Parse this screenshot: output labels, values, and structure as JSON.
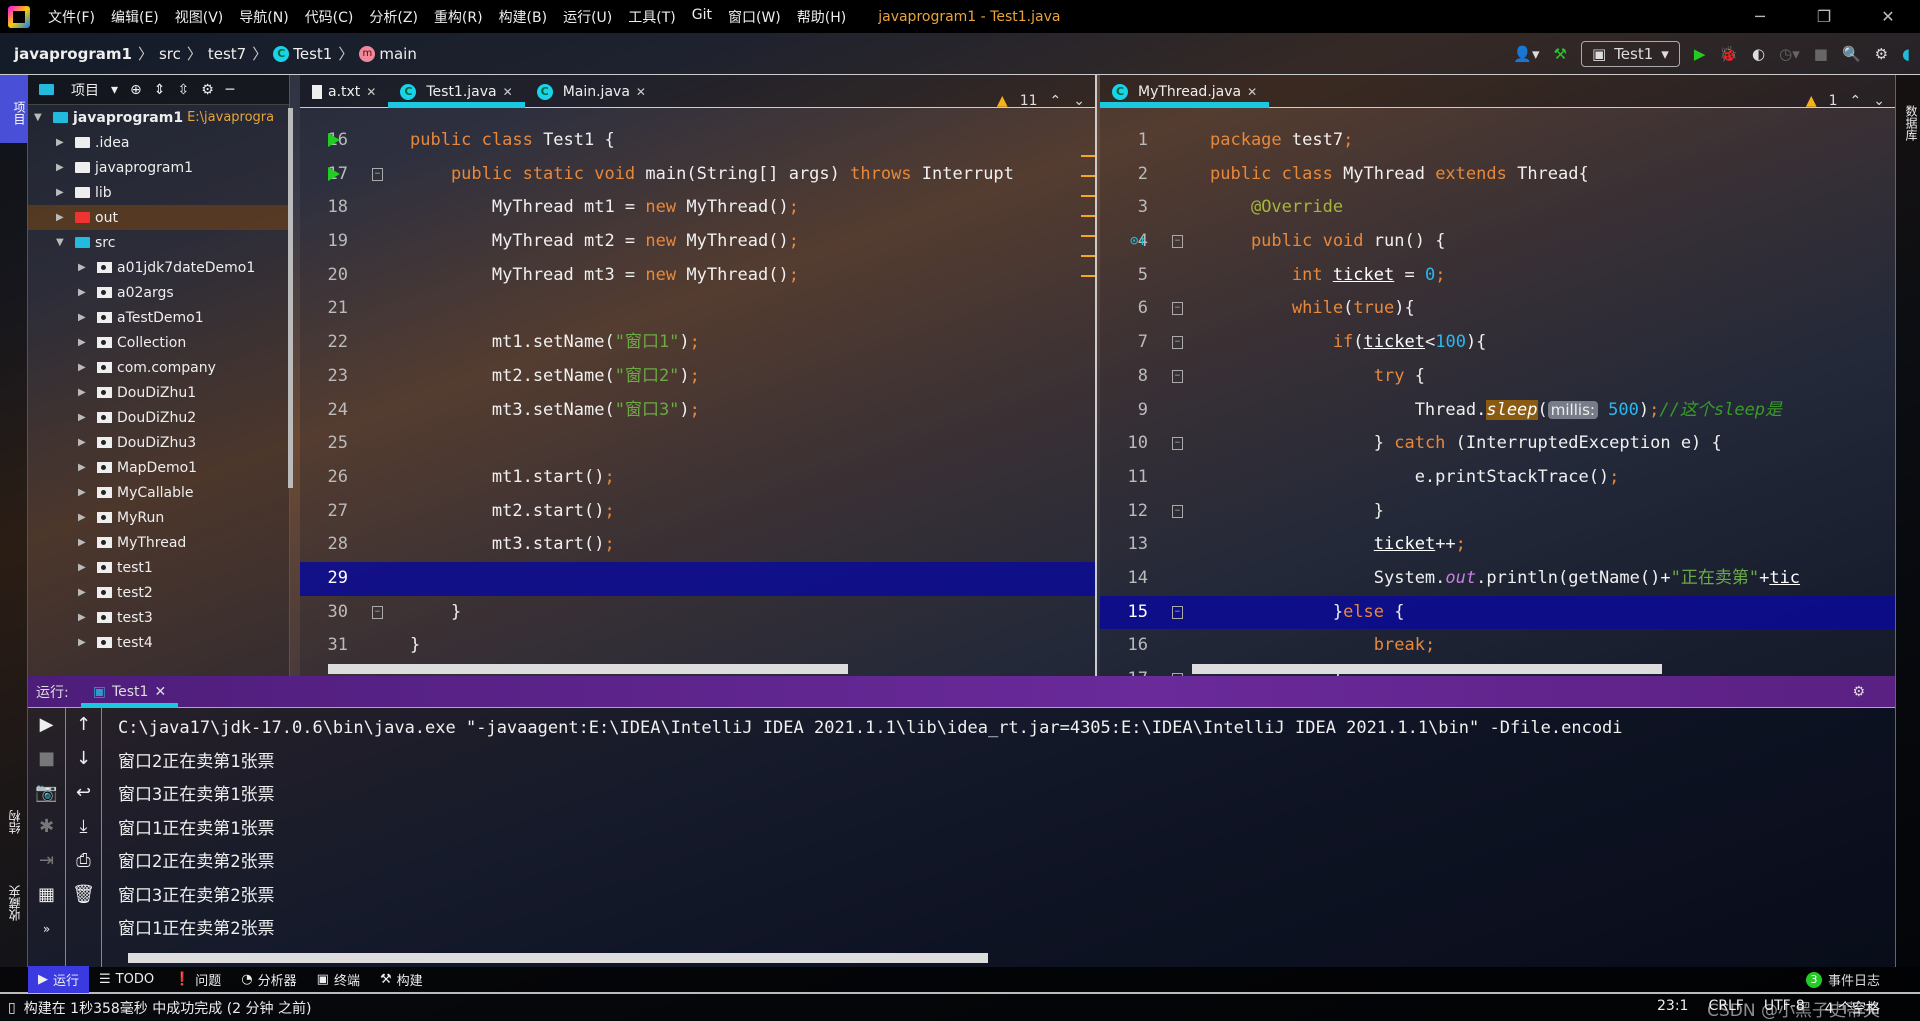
{
  "window": {
    "title": "javaprogram1 - Test1.java",
    "menu": [
      "文件(F)",
      "编辑(E)",
      "视图(V)",
      "导航(N)",
      "代码(C)",
      "分析(Z)",
      "重构(R)",
      "构建(B)",
      "运行(U)",
      "工具(T)",
      "Git",
      "窗口(W)",
      "帮助(H)"
    ]
  },
  "breadcrumb": {
    "project": "javaprogram1",
    "src": "src",
    "pkg": "test7",
    "cls": "Test1",
    "method": "main"
  },
  "toolbar": {
    "run_config": "Test1"
  },
  "left_stripe": {
    "project": "项目",
    "structure": "结构",
    "favorites": "收藏夹"
  },
  "right_stripe": {
    "database": "数据库"
  },
  "project": {
    "title": "项目",
    "root": "javaprogram1",
    "root_path": "E:\\javaprogra",
    "items": [
      {
        "label": ".idea",
        "type": "folder",
        "depth": 1
      },
      {
        "label": "javaprogram1",
        "type": "folder",
        "depth": 1
      },
      {
        "label": "lib",
        "type": "folder",
        "depth": 1
      },
      {
        "label": "out",
        "type": "folder-red",
        "depth": 1
      },
      {
        "label": "src",
        "type": "folder-blue",
        "depth": 1,
        "open": true
      },
      {
        "label": "a01jdk7dateDemo1",
        "type": "pkg",
        "depth": 2
      },
      {
        "label": "a02args",
        "type": "pkg",
        "depth": 2
      },
      {
        "label": "aTestDemo1",
        "type": "pkg",
        "depth": 2
      },
      {
        "label": "Collection",
        "type": "pkg",
        "depth": 2
      },
      {
        "label": "com.company",
        "type": "pkg",
        "depth": 2
      },
      {
        "label": "DouDiZhu1",
        "type": "pkg",
        "depth": 2
      },
      {
        "label": "DouDiZhu2",
        "type": "pkg",
        "depth": 2
      },
      {
        "label": "DouDiZhu3",
        "type": "pkg",
        "depth": 2
      },
      {
        "label": "MapDemo1",
        "type": "pkg",
        "depth": 2
      },
      {
        "label": "MyCallable",
        "type": "pkg",
        "depth": 2
      },
      {
        "label": "MyRun",
        "type": "pkg",
        "depth": 2
      },
      {
        "label": "MyThread",
        "type": "pkg",
        "depth": 2
      },
      {
        "label": "test1",
        "type": "pkg",
        "depth": 2
      },
      {
        "label": "test2",
        "type": "pkg",
        "depth": 2
      },
      {
        "label": "test3",
        "type": "pkg",
        "depth": 2
      },
      {
        "label": "test4",
        "type": "pkg",
        "depth": 2
      }
    ]
  },
  "editor1": {
    "tabs": [
      {
        "label": "a.txt",
        "icon": "text-file-icon"
      },
      {
        "label": "Test1.java",
        "icon": "class-icon",
        "active": true
      },
      {
        "label": "Main.java",
        "icon": "class-icon"
      }
    ],
    "warnings": "11",
    "current_line": "29",
    "lines": [
      {
        "n": "16",
        "run": true,
        "t": [
          [
            "public class ",
            "k"
          ],
          [
            "Test1 {",
            "plain"
          ]
        ]
      },
      {
        "n": "17",
        "run": true,
        "fold": true,
        "t": [
          [
            "    public static void ",
            "k"
          ],
          [
            "main",
            "f"
          ],
          [
            "(String[] args) ",
            "plain"
          ],
          [
            "throws ",
            "k"
          ],
          [
            "Interrupt",
            "plain"
          ]
        ]
      },
      {
        "n": "18",
        "t": [
          [
            "        MyThread mt1 = ",
            "plain"
          ],
          [
            "new ",
            "k"
          ],
          [
            "MyThread()",
            "plain"
          ],
          [
            ";",
            "k"
          ]
        ]
      },
      {
        "n": "19",
        "t": [
          [
            "        MyThread mt2 = ",
            "plain"
          ],
          [
            "new ",
            "k"
          ],
          [
            "MyThread()",
            "plain"
          ],
          [
            ";",
            "k"
          ]
        ]
      },
      {
        "n": "20",
        "t": [
          [
            "        MyThread mt3 = ",
            "plain"
          ],
          [
            "new ",
            "k"
          ],
          [
            "MyThread()",
            "plain"
          ],
          [
            ";",
            "k"
          ]
        ]
      },
      {
        "n": "21",
        "t": []
      },
      {
        "n": "22",
        "t": [
          [
            "        mt1.setName(",
            "plain"
          ],
          [
            "\"窗口1\"",
            "s"
          ],
          [
            ")",
            "plain"
          ],
          [
            ";",
            "k"
          ]
        ]
      },
      {
        "n": "23",
        "t": [
          [
            "        mt2.setName(",
            "plain"
          ],
          [
            "\"窗口2\"",
            "s"
          ],
          [
            ")",
            "plain"
          ],
          [
            ";",
            "k"
          ]
        ]
      },
      {
        "n": "24",
        "t": [
          [
            "        mt3.setName(",
            "plain"
          ],
          [
            "\"窗口3\"",
            "s"
          ],
          [
            ")",
            "plain"
          ],
          [
            ";",
            "k"
          ]
        ]
      },
      {
        "n": "25",
        "t": []
      },
      {
        "n": "26",
        "t": [
          [
            "        mt1.start()",
            "plain"
          ],
          [
            ";",
            "k"
          ]
        ]
      },
      {
        "n": "27",
        "t": [
          [
            "        mt2.start()",
            "plain"
          ],
          [
            ";",
            "k"
          ]
        ]
      },
      {
        "n": "28",
        "t": [
          [
            "        mt3.start()",
            "plain"
          ],
          [
            ";",
            "k"
          ]
        ]
      },
      {
        "n": "29",
        "cur": true,
        "t": []
      },
      {
        "n": "30",
        "fold": true,
        "t": [
          [
            "    }",
            "plain"
          ]
        ]
      },
      {
        "n": "31",
        "t": [
          [
            "}",
            "plain"
          ]
        ]
      }
    ]
  },
  "editor2": {
    "tabs": [
      {
        "label": "MyThread.java",
        "icon": "class-icon",
        "active": true
      }
    ],
    "warnings": "1",
    "current_line": "15",
    "lines": [
      {
        "n": "1",
        "t": [
          [
            "package ",
            "k"
          ],
          [
            "test7",
            "plain"
          ],
          [
            ";",
            "k"
          ]
        ]
      },
      {
        "n": "2",
        "t": [
          [
            "public class ",
            "k"
          ],
          [
            "MyThread ",
            "plain"
          ],
          [
            "extends ",
            "k"
          ],
          [
            "Thread{",
            "plain"
          ]
        ]
      },
      {
        "n": "3",
        "t": [
          [
            "    ",
            "plain"
          ],
          [
            "@Override",
            "a"
          ]
        ]
      },
      {
        "n": "4",
        "override": true,
        "fold": true,
        "t": [
          [
            "    public void ",
            "k"
          ],
          [
            "run",
            "f"
          ],
          [
            "() {",
            "plain"
          ]
        ]
      },
      {
        "n": "5",
        "t": [
          [
            "        int ",
            "k"
          ],
          [
            "ticket",
            "u"
          ],
          [
            " = ",
            "plain"
          ],
          [
            "0",
            "n"
          ],
          [
            ";",
            "k"
          ]
        ]
      },
      {
        "n": "6",
        "fold": true,
        "t": [
          [
            "        while",
            "k"
          ],
          [
            "(",
            "plain"
          ],
          [
            "true",
            "k"
          ],
          [
            "){",
            "plain"
          ]
        ]
      },
      {
        "n": "7",
        "fold": true,
        "t": [
          [
            "            if",
            "k"
          ],
          [
            "(",
            "plain"
          ],
          [
            "ticket",
            "u"
          ],
          [
            "<",
            "plain"
          ],
          [
            "100",
            "n"
          ],
          [
            "){",
            "plain"
          ]
        ]
      },
      {
        "n": "8",
        "fold": true,
        "t": [
          [
            "                try ",
            "k"
          ],
          [
            "{",
            "plain"
          ]
        ]
      },
      {
        "n": "9",
        "t": [
          [
            "                    Thread.",
            "plain"
          ],
          [
            "sleep",
            "sl"
          ],
          [
            "(",
            "plain"
          ],
          [
            "millis:",
            "ph"
          ],
          [
            " 500",
            "n"
          ],
          [
            ")",
            "plain"
          ],
          [
            ";",
            "k"
          ],
          [
            "//这个sleep是",
            "c"
          ]
        ]
      },
      {
        "n": "10",
        "fold": true,
        "t": [
          [
            "                } ",
            "plain"
          ],
          [
            "catch ",
            "k"
          ],
          [
            "(InterruptedException e) {",
            "plain"
          ]
        ]
      },
      {
        "n": "11",
        "t": [
          [
            "                    e.printStackTrace()",
            "plain"
          ],
          [
            ";",
            "k"
          ]
        ]
      },
      {
        "n": "12",
        "fold": true,
        "t": [
          [
            "                }",
            "plain"
          ]
        ]
      },
      {
        "n": "13",
        "t": [
          [
            "                ",
            "plain"
          ],
          [
            "ticket",
            "u"
          ],
          [
            "++",
            "plain"
          ],
          [
            ";",
            "k"
          ]
        ]
      },
      {
        "n": "14",
        "t": [
          [
            "                System.",
            "plain"
          ],
          [
            "out",
            "it"
          ],
          [
            ".println(getName()+",
            "plain"
          ],
          [
            "\"正在卖第\"",
            "s"
          ],
          [
            "+",
            "plain"
          ],
          [
            "tic",
            "u"
          ]
        ]
      },
      {
        "n": "15",
        "cur": true,
        "fold": true,
        "t": [
          [
            "            }",
            "plain"
          ],
          [
            "else ",
            "k"
          ],
          [
            "{",
            "plain"
          ]
        ]
      },
      {
        "n": "16",
        "t": [
          [
            "                break",
            "k"
          ],
          [
            ";",
            "k"
          ]
        ]
      },
      {
        "n": "17",
        "fold": true,
        "t": [
          [
            "            }",
            "plain"
          ]
        ]
      }
    ]
  },
  "run": {
    "label": "运行:",
    "tab": "Test1",
    "output": [
      "C:\\java17\\jdk-17.0.6\\bin\\java.exe \"-javaagent:E:\\IDEA\\IntelliJ IDEA 2021.1.1\\lib\\idea_rt.jar=4305:E:\\IDEA\\IntelliJ IDEA 2021.1.1\\bin\" -Dfile.encodi",
      "窗口2正在卖第1张票",
      "窗口3正在卖第1张票",
      "窗口1正在卖第1张票",
      "窗口2正在卖第2张票",
      "窗口3正在卖第2张票",
      "窗口1正在卖第2张票"
    ]
  },
  "tool_windows": [
    {
      "label": "运行",
      "icon": "play-icon",
      "active": true
    },
    {
      "label": "TODO",
      "icon": "list-icon"
    },
    {
      "label": "问题",
      "icon": "alert-icon"
    },
    {
      "label": "分析器",
      "icon": "profiler-icon"
    },
    {
      "label": "终端",
      "icon": "terminal-icon"
    },
    {
      "label": "构建",
      "icon": "hammer-icon"
    }
  ],
  "event_log": {
    "count": "3",
    "label": "事件日志"
  },
  "status": {
    "message": "构建在 1秒358毫秒 中成功完成 (2 分钟 之前)",
    "position": "23:1",
    "line_sep": "CRLF",
    "encoding": "UTF-8",
    "indent": "4 个空格",
    "watermark": "CSDN @小黑子史蒂夫"
  },
  "colors": {
    "accent": "#1cc8e0",
    "run_header": "#5a2082",
    "current_line": "#0a0a96",
    "tool_active": "#3a3ae0"
  }
}
